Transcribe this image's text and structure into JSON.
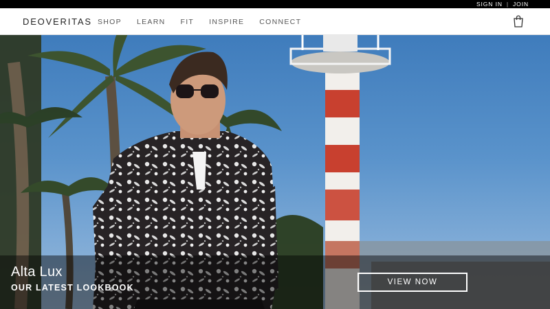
{
  "account": {
    "sign_in": "SIGN IN",
    "separator": "|",
    "join": "JOIN"
  },
  "header": {
    "brand": "DEOVERITAS",
    "menu": [
      {
        "label": "SHOP"
      },
      {
        "label": "LEARN"
      },
      {
        "label": "FIT"
      },
      {
        "label": "INSPIRE"
      },
      {
        "label": "CONNECT"
      }
    ],
    "cart_icon": "shopping-bag-icon"
  },
  "hero": {
    "title": "Alta Lux",
    "subtitle": "OUR LATEST LOOKBOOK",
    "cta": "VIEW NOW"
  },
  "colors": {
    "topbar": "#000000",
    "nav_bg": "#ffffff",
    "sky": "#4a86c4",
    "lighthouse_red": "#c8402f",
    "shirt": "#2a2628"
  }
}
